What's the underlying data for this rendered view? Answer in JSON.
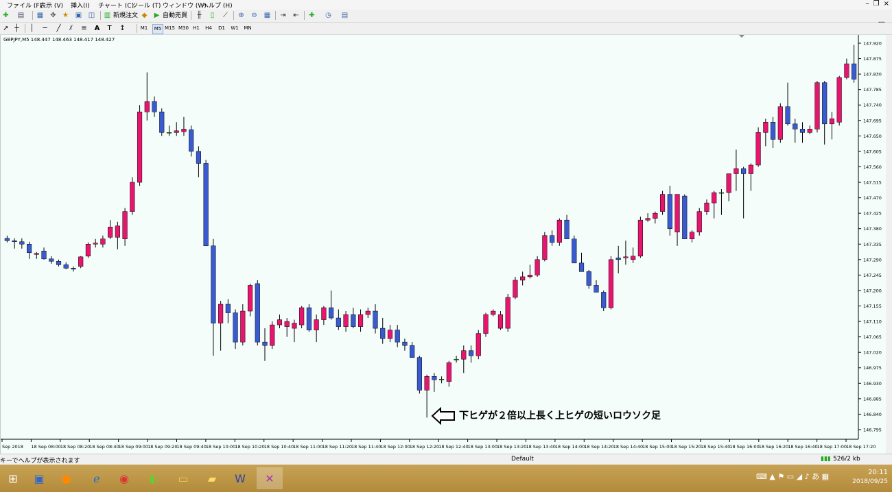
{
  "menu": {
    "items": [
      "ファイル (F)",
      "表示 (V)",
      "挿入(I)",
      "チャート (C)",
      "ツール (T)",
      "ウィンドウ (W)",
      "ヘルプ (H)"
    ],
    "win_minimize": "–",
    "win_restore": "❐",
    "win_close": "×"
  },
  "toolbar1": {
    "new_order": "新規注文",
    "auto_trade": "自動売買"
  },
  "toolbar2": {
    "timeframes": [
      "M1",
      "M5",
      "M15",
      "M30",
      "H1",
      "H4",
      "D1",
      "W1",
      "MN"
    ],
    "text_tool": "A"
  },
  "chart_header": "GBPJPY,M5  148.447 148.463 148.417 148.427",
  "annotation": "下ヒゲが２倍以上長く上ヒゲの短いロウソク足",
  "chart_data": {
    "type": "candlestick",
    "symbol": "GBPJPY,M5",
    "ohlc_label": "148.447 148.463 148.417 148.427",
    "ylim": [
      146.785,
      147.92
    ],
    "y_ticks": [
      "147.920",
      "147.875",
      "147.830",
      "147.785",
      "147.740",
      "147.695",
      "147.650",
      "147.605",
      "147.560",
      "147.515",
      "147.470",
      "147.425",
      "147.380",
      "147.335",
      "147.290",
      "147.245",
      "147.200",
      "147.155",
      "147.110",
      "147.065",
      "147.020",
      "146.975",
      "146.930",
      "146.885",
      "146.840",
      "146.795"
    ],
    "x_labels": [
      "Sep 2018",
      "18 Sep 08:00",
      "18 Sep 08:20",
      "18 Sep 08:40",
      "18 Sep 09:00",
      "18 Sep 09:20",
      "18 Sep 09:40",
      "18 Sep 10:00",
      "18 Sep 10:20",
      "18 Sep 10:40",
      "18 Sep 11:00",
      "18 Sep 11:20",
      "18 Sep 11:40",
      "18 Sep 12:00",
      "18 Sep 12:20",
      "18 Sep 12:40",
      "18 Sep 13:00",
      "18 Sep 13:20",
      "18 Sep 13:40",
      "18 Sep 14:00",
      "18 Sep 14:20",
      "18 Sep 14:40",
      "18 Sep 15:00",
      "18 Sep 15:20",
      "18 Sep 15:40",
      "18 Sep 16:00",
      "18 Sep 16:20",
      "18 Sep 16:40",
      "18 Sep 17:00",
      "18 Sep 17:20"
    ],
    "bull_color": "#e8156f",
    "bear_color": "#3a5bd0",
    "doji_color": "#00c000",
    "candles": [
      [
        147.352,
        147.36,
        147.34,
        147.345
      ],
      [
        147.345,
        147.352,
        147.322,
        147.342
      ],
      [
        147.342,
        147.352,
        147.322,
        147.335
      ],
      [
        147.335,
        147.342,
        147.292,
        147.31
      ],
      [
        147.305,
        147.312,
        147.292,
        147.308
      ],
      [
        147.315,
        147.325,
        147.29,
        147.292
      ],
      [
        147.292,
        147.3,
        147.278,
        147.285
      ],
      [
        147.285,
        147.29,
        147.27,
        147.275
      ],
      [
        147.275,
        147.282,
        147.262,
        147.265
      ],
      [
        147.265,
        147.27,
        147.255,
        147.262
      ],
      [
        147.27,
        147.3,
        147.265,
        147.298
      ],
      [
        147.3,
        147.34,
        147.295,
        147.335
      ],
      [
        147.335,
        147.35,
        147.325,
        147.338
      ],
      [
        147.335,
        147.36,
        147.325,
        147.35
      ],
      [
        147.355,
        147.405,
        147.35,
        147.385
      ],
      [
        147.355,
        147.4,
        147.32,
        147.388
      ],
      [
        147.35,
        147.44,
        147.33,
        147.43
      ],
      [
        147.43,
        147.53,
        147.42,
        147.515
      ],
      [
        147.515,
        147.74,
        147.505,
        147.72
      ],
      [
        147.72,
        147.835,
        147.695,
        147.75
      ],
      [
        147.75,
        147.765,
        147.705,
        147.72
      ],
      [
        147.72,
        147.73,
        147.65,
        147.66
      ],
      [
        147.66,
        147.68,
        147.65,
        147.658
      ],
      [
        147.66,
        147.69,
        147.65,
        147.665
      ],
      [
        147.662,
        147.705,
        147.65,
        147.67
      ],
      [
        147.668,
        147.68,
        147.59,
        147.605
      ],
      [
        147.605,
        147.62,
        147.53,
        147.57
      ],
      [
        147.57,
        147.58,
        147.36,
        147.33
      ],
      [
        147.33,
        147.35,
        147.01,
        147.105
      ],
      [
        147.105,
        147.17,
        147.025,
        147.16
      ],
      [
        147.16,
        147.175,
        147.105,
        147.135
      ],
      [
        147.135,
        147.145,
        147.03,
        147.05
      ],
      [
        147.05,
        147.16,
        147.04,
        147.14
      ],
      [
        147.14,
        147.22,
        147.125,
        147.215
      ],
      [
        147.22,
        147.23,
        147.04,
        147.05
      ],
      [
        147.05,
        147.09,
        146.995,
        147.04
      ],
      [
        147.04,
        147.11,
        147.03,
        147.1
      ],
      [
        147.1,
        147.13,
        147.09,
        147.115
      ],
      [
        147.095,
        147.12,
        147.065,
        147.11
      ],
      [
        147.09,
        147.115,
        147.05,
        147.105
      ],
      [
        147.1,
        147.155,
        147.09,
        147.15
      ],
      [
        147.15,
        147.16,
        147.08,
        147.085
      ],
      [
        147.085,
        147.13,
        147.05,
        147.115
      ],
      [
        147.115,
        147.155,
        147.1,
        147.15
      ],
      [
        147.15,
        147.2,
        147.115,
        147.12
      ],
      [
        147.12,
        147.145,
        147.085,
        147.095
      ],
      [
        147.095,
        147.14,
        147.08,
        147.13
      ],
      [
        147.13,
        147.15,
        147.09,
        147.095
      ],
      [
        147.095,
        147.145,
        147.08,
        147.13
      ],
      [
        147.13,
        147.15,
        147.12,
        147.14
      ],
      [
        147.14,
        147.16,
        147.075,
        147.09
      ],
      [
        147.09,
        147.12,
        147.045,
        147.06
      ],
      [
        147.06,
        147.1,
        147.05,
        147.085
      ],
      [
        147.085,
        147.1,
        147.035,
        147.05
      ],
      [
        147.05,
        147.06,
        147.025,
        147.04
      ],
      [
        147.04,
        147.05,
        147.005,
        147.005
      ],
      [
        147.005,
        147.01,
        146.9,
        146.91
      ],
      [
        146.91,
        146.955,
        146.83,
        146.95
      ],
      [
        146.95,
        146.96,
        146.905,
        146.94
      ],
      [
        146.94,
        146.95,
        146.93,
        146.942
      ],
      [
        146.935,
        146.995,
        146.92,
        146.99
      ],
      [
        147.0,
        147.01,
        146.99,
        147.0
      ],
      [
        147.0,
        147.04,
        146.96,
        147.025
      ],
      [
        147.025,
        147.04,
        146.99,
        147.01
      ],
      [
        147.01,
        147.085,
        147.0,
        147.075
      ],
      [
        147.075,
        147.135,
        147.065,
        147.13
      ],
      [
        147.13,
        147.145,
        147.125,
        147.14
      ],
      [
        147.09,
        147.14,
        147.085,
        147.13
      ],
      [
        147.09,
        147.19,
        147.08,
        147.18
      ],
      [
        147.18,
        147.24,
        147.175,
        147.23
      ],
      [
        147.23,
        147.255,
        147.215,
        147.24
      ],
      [
        147.24,
        147.275,
        147.235,
        147.245
      ],
      [
        147.245,
        147.3,
        147.24,
        147.29
      ],
      [
        147.29,
        147.37,
        147.285,
        147.36
      ],
      [
        147.36,
        147.375,
        147.33,
        147.34
      ],
      [
        147.34,
        147.41,
        147.33,
        147.405
      ],
      [
        147.405,
        147.42,
        147.35,
        147.35
      ],
      [
        147.35,
        147.36,
        147.28,
        147.28
      ],
      [
        147.28,
        147.31,
        147.255,
        147.255
      ],
      [
        147.255,
        147.26,
        147.205,
        147.215
      ],
      [
        147.215,
        147.23,
        147.195,
        147.195
      ],
      [
        147.195,
        147.2,
        147.14,
        147.15
      ],
      [
        147.15,
        147.3,
        147.145,
        147.29
      ],
      [
        147.295,
        147.33,
        147.25,
        147.29
      ],
      [
        147.295,
        147.345,
        147.275,
        147.298
      ],
      [
        147.29,
        147.325,
        147.28,
        147.3
      ],
      [
        147.3,
        147.415,
        147.295,
        147.405
      ],
      [
        147.405,
        147.425,
        147.4,
        147.41
      ],
      [
        147.41,
        147.43,
        147.395,
        147.425
      ],
      [
        147.43,
        147.49,
        147.42,
        147.48
      ],
      [
        147.48,
        147.505,
        147.36,
        147.38
      ],
      [
        147.37,
        147.45,
        147.33,
        147.48
      ],
      [
        147.475,
        147.48,
        147.35,
        147.35
      ],
      [
        147.35,
        147.375,
        147.34,
        147.37
      ],
      [
        147.37,
        147.44,
        147.36,
        147.43
      ],
      [
        147.43,
        147.465,
        147.42,
        147.455
      ],
      [
        147.455,
        147.49,
        147.41,
        147.485
      ],
      [
        147.485,
        147.495,
        147.42,
        147.485
      ],
      [
        147.485,
        147.54,
        147.46,
        147.54
      ],
      [
        147.54,
        147.61,
        147.49,
        147.555
      ],
      [
        147.555,
        147.56,
        147.41,
        147.54
      ],
      [
        147.54,
        147.57,
        147.49,
        147.565
      ],
      [
        147.565,
        147.675,
        147.56,
        147.66
      ],
      [
        147.66,
        147.7,
        147.62,
        147.69
      ],
      [
        147.69,
        147.705,
        147.615,
        147.64
      ],
      [
        147.64,
        147.745,
        147.63,
        147.735
      ],
      [
        147.735,
        147.805,
        147.68,
        147.685
      ],
      [
        147.685,
        147.7,
        147.63,
        147.67
      ],
      [
        147.67,
        147.69,
        147.63,
        147.66
      ],
      [
        147.66,
        147.68,
        147.655,
        147.67
      ],
      [
        147.67,
        147.81,
        147.66,
        147.805
      ],
      [
        147.805,
        147.81,
        147.625,
        147.685
      ],
      [
        147.685,
        147.72,
        147.64,
        147.7
      ],
      [
        147.69,
        147.825,
        147.68,
        147.82
      ],
      [
        147.82,
        147.875,
        147.815,
        147.86
      ],
      [
        147.86,
        147.915,
        147.805,
        147.815
      ]
    ]
  },
  "status": {
    "help_text": "キーでヘルプが表示されます",
    "profile": "Default",
    "traffic": "526/2 kb"
  },
  "taskbar": {
    "ime_mode": "あ",
    "time": "20:11",
    "date": "2018/09/25"
  }
}
